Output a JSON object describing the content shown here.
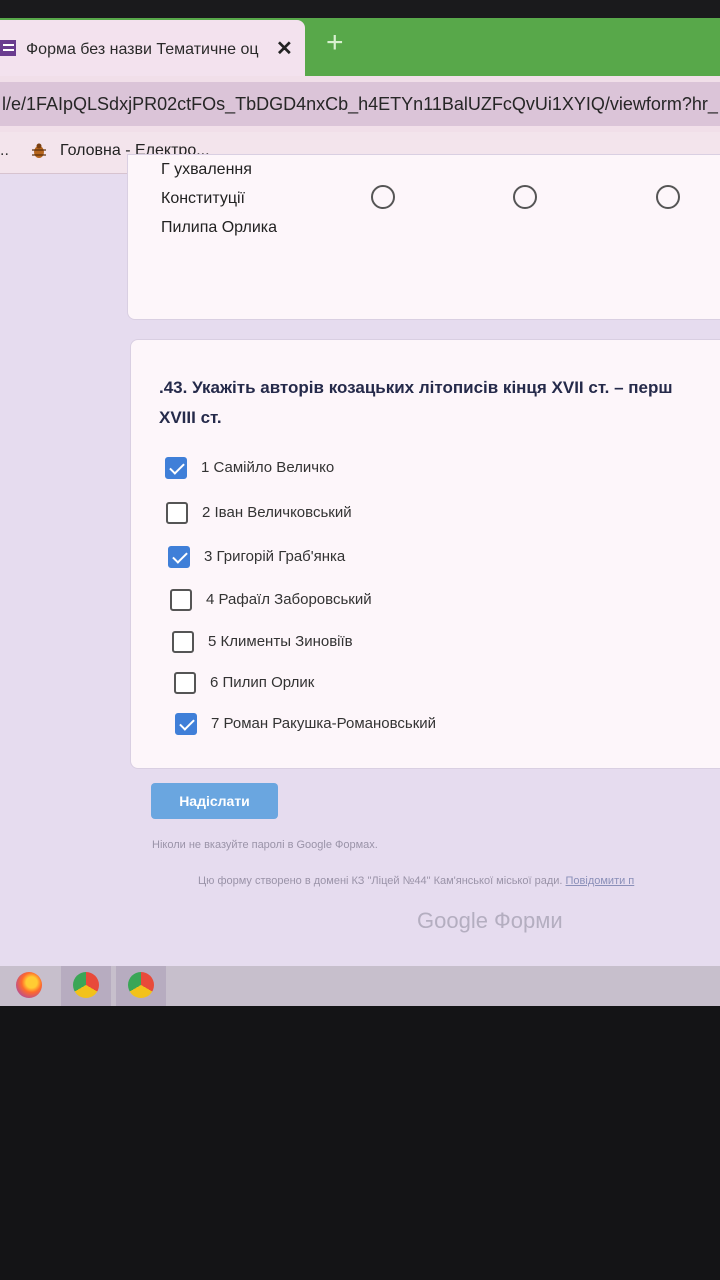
{
  "browser": {
    "tab_title": "Форма без назви Тематичне оц",
    "tab_close": "✕",
    "new_tab": "+",
    "url": "l/e/1FAIpQLSdxjPR02ctFOs_TbDGD4nxCb_h4ETYn11BalUZFcQvUi1XYIQ/viewform?hr_",
    "bookmark_overflow": "..",
    "bookmark_label": "Головна - Електро..."
  },
  "previous_question": {
    "option_lines": [
      "Г ухвалення",
      "Конституції",
      "Пилипа Орлика"
    ]
  },
  "question": {
    "title_line1": ".43. Укажіть авторів козацьких літописів кінця XVII ст. – перш",
    "title_line2": "XVIII ст.",
    "options": [
      {
        "label": "1 Самійло Величко",
        "checked": true
      },
      {
        "label": "2 Іван Величковський",
        "checked": false
      },
      {
        "label": "3 Григорій Граб'янка",
        "checked": true
      },
      {
        "label": "4 Рафаїл Заборовський",
        "checked": false
      },
      {
        "label": "5 Клименты Зиновіїв",
        "checked": false
      },
      {
        "label": "6 Пилип Орлик",
        "checked": false
      },
      {
        "label": "7 Роман Ракушка-Романовський",
        "checked": true
      }
    ]
  },
  "form": {
    "submit_label": "Надіслати",
    "never_password": "Ніколи не вказуйте паролі в Google Формах.",
    "created_in": "Цю форму створено в домені КЗ \"Ліцей №44\" Кам'янської міської ради.",
    "report_link": "Повідомити п",
    "brand": "Google Форми"
  },
  "colors": {
    "accent": "#3f7fd8",
    "tab_strip": "#58a84a"
  }
}
